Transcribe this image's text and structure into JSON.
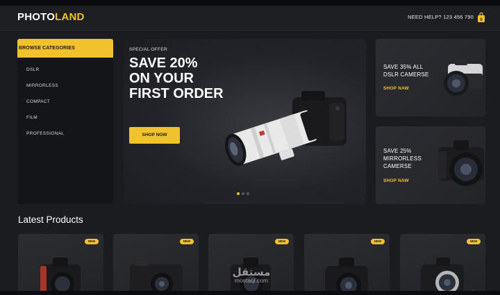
{
  "header": {
    "logo_part1": "PHOTO",
    "logo_part2": "LAND",
    "help_text": "NEED HELP? 123 456 790",
    "cart_icon": "shopping-bag-icon",
    "cart_count": "0"
  },
  "sidebar": {
    "heading": "BROWSE CATEGORIES",
    "items": [
      {
        "label": "DSLR"
      },
      {
        "label": "MIRRORLESS"
      },
      {
        "label": "COMPACT"
      },
      {
        "label": "FILM"
      },
      {
        "label": "PROFESSIONAL"
      }
    ]
  },
  "hero": {
    "tag": "SPECIAL OFFER",
    "title_line1": "SAVE 20%",
    "title_line2": "ON YOUR",
    "title_line3": "FIRST ORDER",
    "button": "SHOP NOW",
    "slides_total": 3,
    "active_slide": 1
  },
  "promos": [
    {
      "line1": "SAVE 35% ALL",
      "line2": "DSLR CAMERSE",
      "line3": "",
      "link": "SHOP NAW"
    },
    {
      "line1": "SAVE 25%",
      "line2": "MIRRORLESS",
      "line3": "CAMERSE",
      "link": "SHOP NAW"
    }
  ],
  "latest": {
    "title": "Latest Products",
    "products": [
      {
        "badge": "NEW",
        "image": "nikon-dslr-camera"
      },
      {
        "badge": "NEW",
        "image": "compact-camera"
      },
      {
        "badge": "NEW",
        "image": "dslr-camera"
      },
      {
        "badge": "NEW",
        "image": "canon-dslr-camera"
      },
      {
        "badge": "NEW",
        "image": "mirrorless-camera"
      }
    ]
  },
  "watermark": {
    "arabic": "مستقل",
    "latin": "mostaql.com"
  },
  "colors": {
    "accent": "#f2c12e",
    "background": "#1b1c20",
    "card": "#26272b"
  }
}
